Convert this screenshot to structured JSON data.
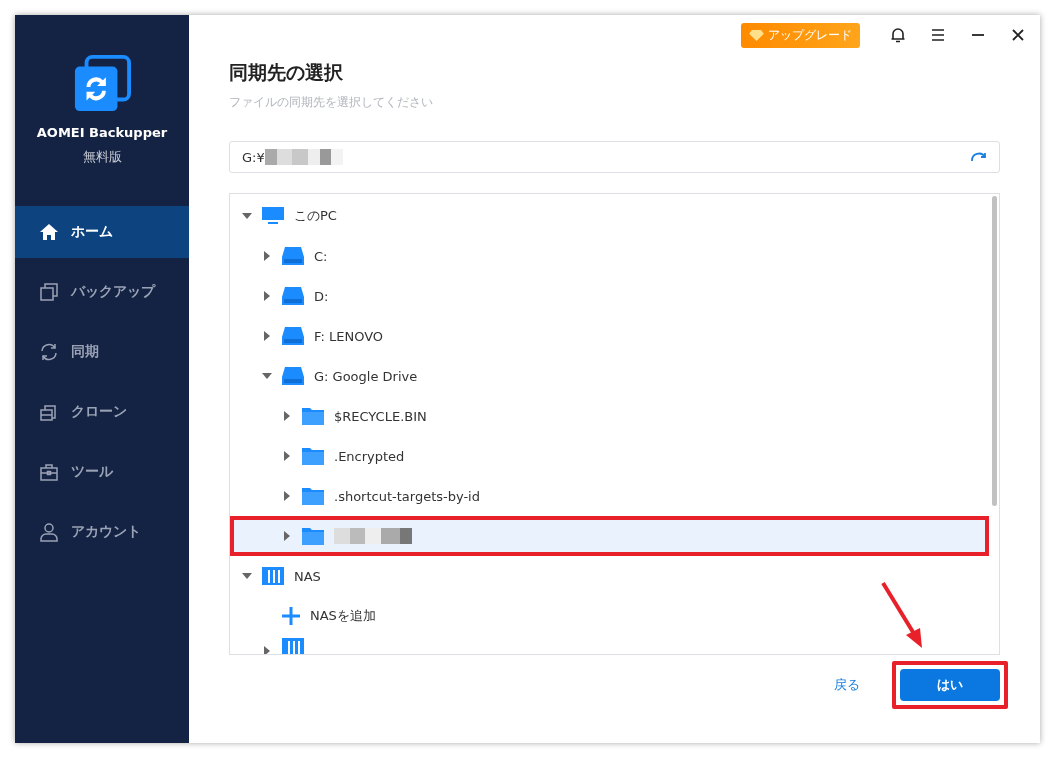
{
  "app": {
    "name": "AOMEI Backupper",
    "edition": "無料版"
  },
  "title_bar": {
    "upgrade": "アップグレード"
  },
  "sidebar": {
    "items": [
      {
        "label": "ホーム",
        "kind": "home",
        "selected": true
      },
      {
        "label": "バックアップ",
        "kind": "backup",
        "selected": false
      },
      {
        "label": "同期",
        "kind": "sync",
        "selected": false
      },
      {
        "label": "クローン",
        "kind": "clone",
        "selected": false
      },
      {
        "label": "ツール",
        "kind": "tools",
        "selected": false
      },
      {
        "label": "アカウント",
        "kind": "account",
        "selected": false
      }
    ]
  },
  "heading": "同期先の選択",
  "subheading": "ファイルの同期先を選択してください",
  "path_field": {
    "value": "G:¥",
    "redacted": true
  },
  "tree": [
    {
      "label": "このPC",
      "kind": "pc",
      "expanded": true,
      "selected": false,
      "children": [
        {
          "label": "C:",
          "kind": "drive",
          "expanded": false,
          "selected": false
        },
        {
          "label": "D:",
          "kind": "drive",
          "expanded": false,
          "selected": false
        },
        {
          "label": "F: LENOVO",
          "kind": "drive",
          "expanded": false,
          "selected": false
        },
        {
          "label": "G: Google Drive",
          "kind": "drive",
          "expanded": true,
          "selected": false,
          "children": [
            {
              "label": "$RECYCLE.BIN",
              "kind": "folder",
              "expanded": false,
              "selected": false
            },
            {
              "label": ".Encrypted",
              "kind": "folder",
              "expanded": false,
              "selected": false
            },
            {
              "label": ".shortcut-targets-by-id",
              "kind": "folder",
              "expanded": false,
              "selected": false
            },
            {
              "kind": "folder",
              "expanded": false,
              "selected": true,
              "highlighted": true,
              "redacted": true
            }
          ]
        }
      ]
    },
    {
      "label": "NAS",
      "kind": "nas",
      "expanded": true,
      "selected": false,
      "children": [
        {
          "label": "NASを追加",
          "kind": "add"
        },
        {
          "kind": "nas",
          "expanded": false,
          "selected": false,
          "cut": true
        }
      ]
    }
  ],
  "buttons": {
    "back": "戻る",
    "ok": {
      "label": "はい",
      "highlighted": true
    }
  }
}
